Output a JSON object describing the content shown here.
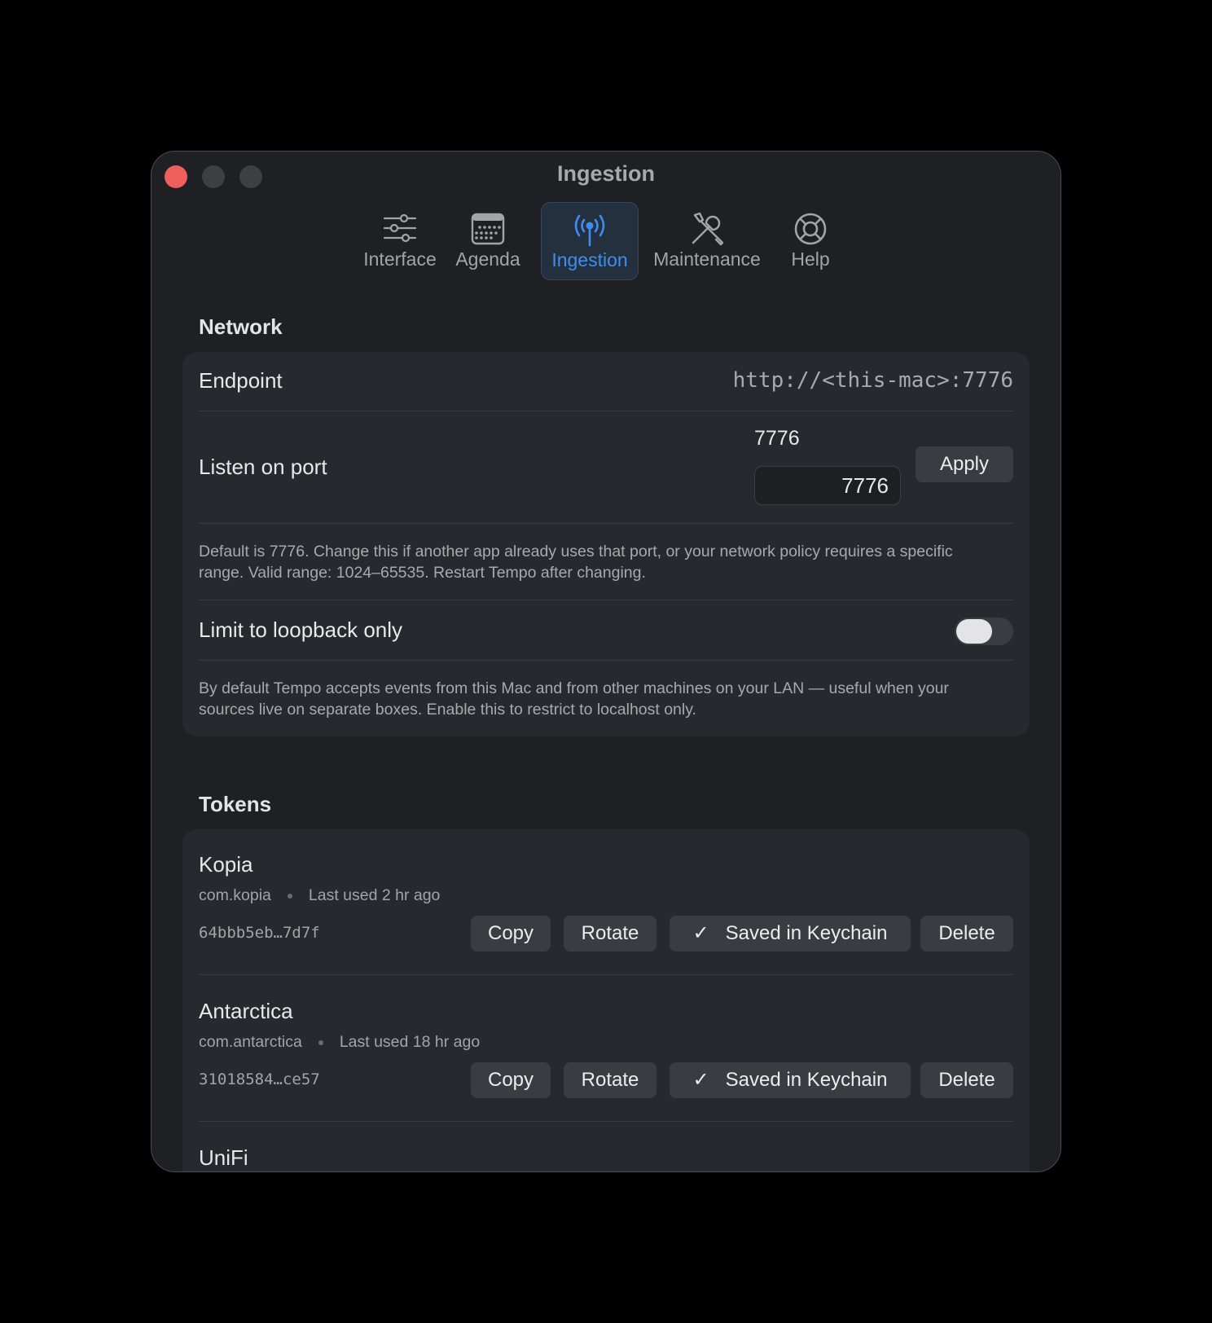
{
  "window": {
    "title": "Ingestion"
  },
  "toolbar": {
    "tabs": [
      {
        "label": "Interface",
        "icon": "sliders-icon"
      },
      {
        "label": "Agenda",
        "icon": "calendar-icon"
      },
      {
        "label": "Ingestion",
        "icon": "antenna-icon",
        "active": true
      },
      {
        "label": "Maintenance",
        "icon": "wrench-screwdriver-icon"
      },
      {
        "label": "Help",
        "icon": "lifebuoy-icon"
      }
    ]
  },
  "network": {
    "title": "Network",
    "endpoint_label": "Endpoint",
    "endpoint_value": "http://<this-mac>:7776",
    "port_label": "Listen on port",
    "port_caption": "7776",
    "port_value": "7776",
    "apply_label": "Apply",
    "port_help": "Default is 7776. Change this if another app already uses that port, or your network policy requires a specific range. Valid range: 1024–65535. Restart Tempo after changing.",
    "loopback_label": "Limit to loopback only",
    "loopback_enabled": false,
    "loopback_help": "By default Tempo accepts events from this Mac and from other machines on your LAN — useful when your sources live on separate boxes. Enable this to restrict to localhost only."
  },
  "tokens": {
    "title": "Tokens",
    "copy_label": "Copy",
    "rotate_label": "Rotate",
    "keychain_label": "Saved in Keychain",
    "keychain_check": "✓",
    "delete_label": "Delete",
    "items": [
      {
        "name": "Kopia",
        "bundle": "com.kopia",
        "last_used": "Last used 2 hr ago",
        "key": "64bbb5eb…7d7f"
      },
      {
        "name": "Antarctica",
        "bundle": "com.antarctica",
        "last_used": "Last used 18 hr ago",
        "key": "31018584…ce57"
      },
      {
        "name": "UniFi"
      }
    ]
  },
  "colors": {
    "accent": "#3e8ef2",
    "close": "#ec5f5a",
    "background": "#1f2024",
    "card": "#28292e"
  }
}
